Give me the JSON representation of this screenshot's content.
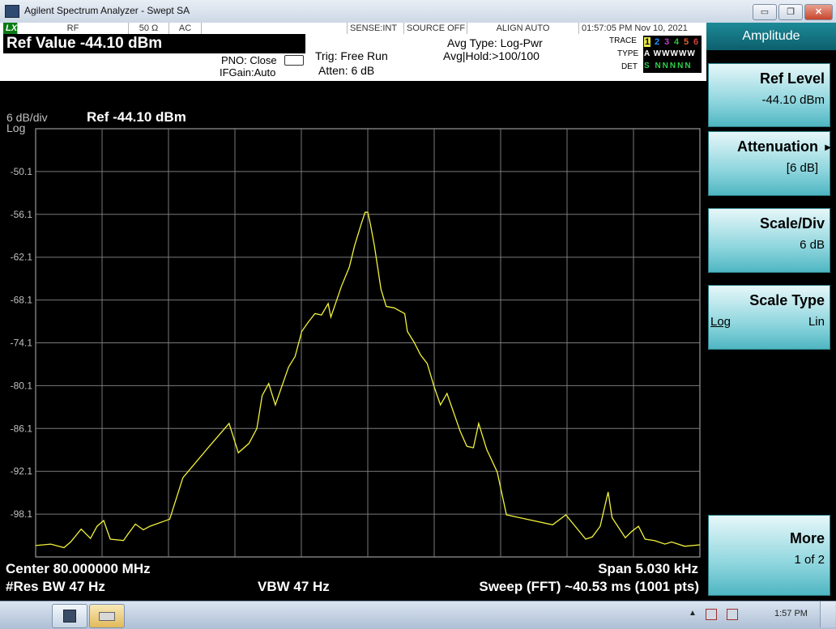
{
  "window": {
    "title": "Agilent Spectrum Analyzer - Swept SA",
    "min_label": "▭",
    "restore_label": "❐",
    "close_label": "✕"
  },
  "status": {
    "lxi": "LXI",
    "rf": "RF",
    "impedance": "50 Ω",
    "coupling": "AC",
    "sense": "SENSE:INT",
    "source": "SOURCE OFF",
    "align": "ALIGN AUTO",
    "datetime": "01:57:05 PM Nov 10, 2021"
  },
  "header": {
    "ref_value": "Ref Value -44.10 dBm",
    "pno": "PNO: Close",
    "ifgain": "IFGain:Auto",
    "trig": "Trig: Free Run",
    "atten": "Atten: 6 dB",
    "avg_type": "Avg Type: Log-Pwr",
    "avg_hold": "Avg|Hold:>100/100",
    "trace_label": "TRACE",
    "type_label": "TYPE",
    "det_label": "DET",
    "trace_numbers": [
      "1",
      "2",
      "3",
      "4",
      "5",
      "6"
    ],
    "type_values": "A WWWWW",
    "det_values": "S NNNNN"
  },
  "plot": {
    "scale_div": "6 dB/div",
    "scale_type": "Log",
    "ref_label": "Ref -44.10 dBm",
    "center": "Center 80.000000 MHz",
    "res_bw": "#Res BW 47 Hz",
    "vbw": "VBW 47 Hz",
    "span": "Span 5.030 kHz",
    "sweep": "Sweep (FFT)  ~40.53 ms (1001 pts)",
    "trace_color": "#f2f23c",
    "grid_color": "#7a7a7a"
  },
  "chart_data": {
    "type": "line",
    "title": "",
    "xlabel": "",
    "ylabel": "",
    "y_ticks": [
      "-50.1",
      "-56.1",
      "-62.1",
      "-68.1",
      "-74.1",
      "-80.1",
      "-86.1",
      "-92.1",
      "-98.1"
    ],
    "ylim": [
      -104.1,
      -44.1
    ],
    "x_range_khz": [
      -2.515,
      2.515
    ],
    "grid": true,
    "series": [
      {
        "x": [
          -2.515,
          -2.4,
          -2.3,
          -2.25,
          -2.17,
          -2.1,
          -2.05,
          -2.0,
          -1.95,
          -1.85,
          -1.82,
          -1.76,
          -1.7,
          -1.65,
          -1.5,
          -1.4,
          -1.2,
          -1.05,
          -0.98,
          -0.9,
          -0.84,
          -0.8,
          -0.75,
          -0.7,
          -0.6,
          -0.55,
          -0.5,
          -0.45,
          -0.4,
          -0.35,
          -0.3,
          -0.28,
          -0.2,
          -0.14,
          -0.1,
          -0.05,
          -0.02,
          0.0,
          0.02,
          0.05,
          0.1,
          0.14,
          0.2,
          0.28,
          0.3,
          0.35,
          0.4,
          0.45,
          0.5,
          0.55,
          0.6,
          0.7,
          0.75,
          0.8,
          0.84,
          0.9,
          0.98,
          1.05,
          1.2,
          1.4,
          1.5,
          1.65,
          1.7,
          1.76,
          1.82,
          1.85,
          1.95,
          2.0,
          2.05,
          2.1,
          2.17,
          2.25,
          2.3,
          2.4,
          2.515
        ],
        "y": [
          -102.5,
          -102.3,
          -102.8,
          -102.0,
          -100.2,
          -101.5,
          -99.8,
          -99.0,
          -101.6,
          -101.8,
          -101.0,
          -99.5,
          -100.3,
          -99.8,
          -98.8,
          -93.0,
          -88.6,
          -85.4,
          -89.5,
          -88.2,
          -86.1,
          -81.5,
          -79.8,
          -82.8,
          -77.5,
          -76.0,
          -72.5,
          -71.2,
          -70.0,
          -70.2,
          -68.6,
          -70.5,
          -66.2,
          -63.5,
          -60.5,
          -57.5,
          -55.8,
          -55.8,
          -57.5,
          -60.5,
          -66.6,
          -69.0,
          -69.2,
          -70.0,
          -72.5,
          -74.0,
          -75.8,
          -77.0,
          -80.1,
          -82.8,
          -81.2,
          -86.5,
          -88.6,
          -88.8,
          -85.4,
          -89.0,
          -92.2,
          -98.2,
          -98.8,
          -99.6,
          -98.2,
          -101.6,
          -101.3,
          -99.8,
          -95.0,
          -98.6,
          -101.4,
          -100.5,
          -99.8,
          -101.6,
          -101.8,
          -102.3,
          -102.0,
          -102.6,
          -102.4
        ]
      }
    ]
  },
  "softkeys": {
    "title": "Amplitude",
    "keys": [
      {
        "label": "Ref Level",
        "value": "-44.10 dBm"
      },
      {
        "label": "Attenuation",
        "value": "[6 dB]"
      },
      {
        "label": "Scale/Div",
        "value": "6 dB"
      },
      {
        "label": "Scale Type",
        "value_left": "Log",
        "value_right": "Lin"
      },
      {
        "label": "More",
        "value": "1 of 2"
      }
    ]
  },
  "taskbar": {
    "clock": "1:57 PM",
    "tray_arrow": "▲"
  }
}
